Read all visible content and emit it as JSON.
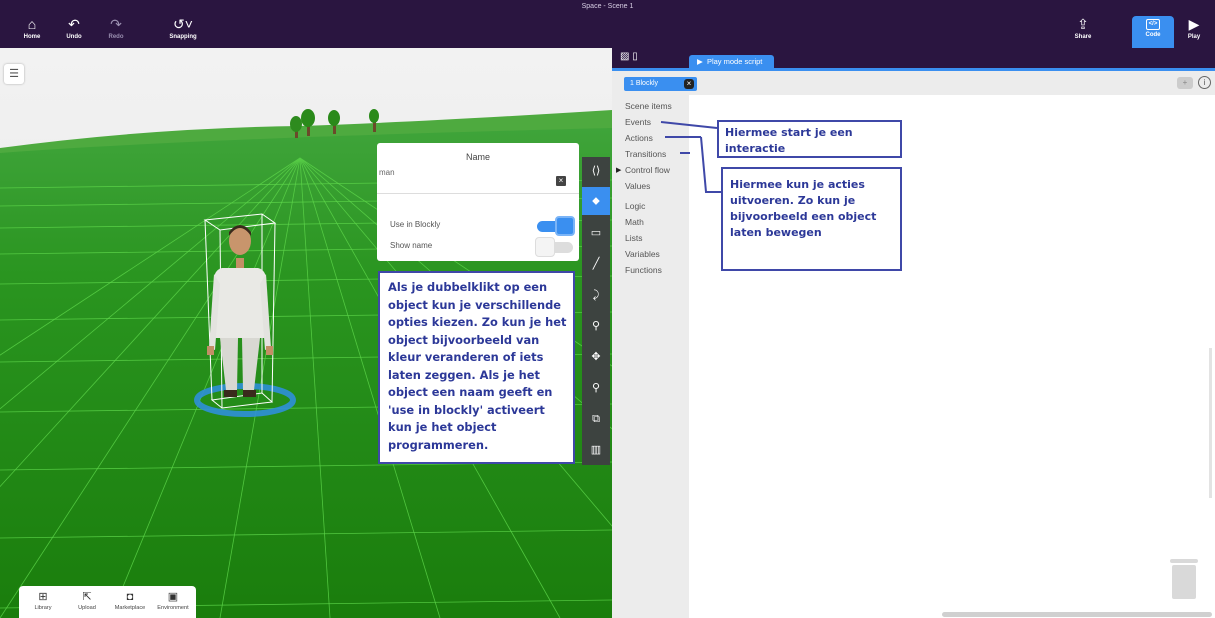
{
  "window": {
    "title": "Space - Scene 1"
  },
  "toolbar": {
    "home": "Home",
    "undo": "Undo",
    "redo": "Redo",
    "snapping": "Snapping",
    "share": "Share",
    "code": "Code",
    "play": "Play"
  },
  "properties": {
    "name_label": "Name",
    "name_value": "man",
    "use_in_blockly_label": "Use in Blockly",
    "use_in_blockly_on": true,
    "show_name_label": "Show name",
    "show_name_on": false
  },
  "tools": [
    {
      "icon": "code-icon"
    },
    {
      "icon": "tag-icon",
      "active": true
    },
    {
      "icon": "speech-bubble-icon"
    },
    {
      "icon": "pen-icon"
    },
    {
      "icon": "animation-icon"
    },
    {
      "icon": "walk-icon"
    },
    {
      "icon": "move-icon"
    },
    {
      "icon": "search-icon"
    },
    {
      "icon": "duplicate-icon"
    },
    {
      "icon": "trash-icon"
    }
  ],
  "bottom_bar": {
    "library": "Library",
    "upload": "Upload",
    "marketplace": "Marketplace",
    "environment": "Environment"
  },
  "code_panel": {
    "play_mode_tab": "Play mode script",
    "blockly_tab": "1  Blockly",
    "plus": "+",
    "info": "i",
    "categories": [
      "Scene items",
      "Events",
      "Actions",
      "Transitions",
      "Control flow",
      "Values",
      "Logic",
      "Math",
      "Lists",
      "Variables",
      "Functions"
    ]
  },
  "annotations": {
    "events": "Hiermee start je een interactie",
    "actions": "Hiermee kun je acties uitvoeren. Zo kun je bijvoorbeeld een object laten bewegen",
    "object": "Als je dubbelklikt op een object kun je verschillende opties kiezen. Zo kun je het object bijvoorbeeld van kleur veranderen of iets laten zeggen. Als je het object een naam geeft en 'use in blockly' activeert kun je het object programmeren."
  },
  "colors": {
    "topbar": "#2a1540",
    "accent": "#3a8ff0",
    "ground": "#1f8c12",
    "callout_border": "#3f48a8"
  }
}
